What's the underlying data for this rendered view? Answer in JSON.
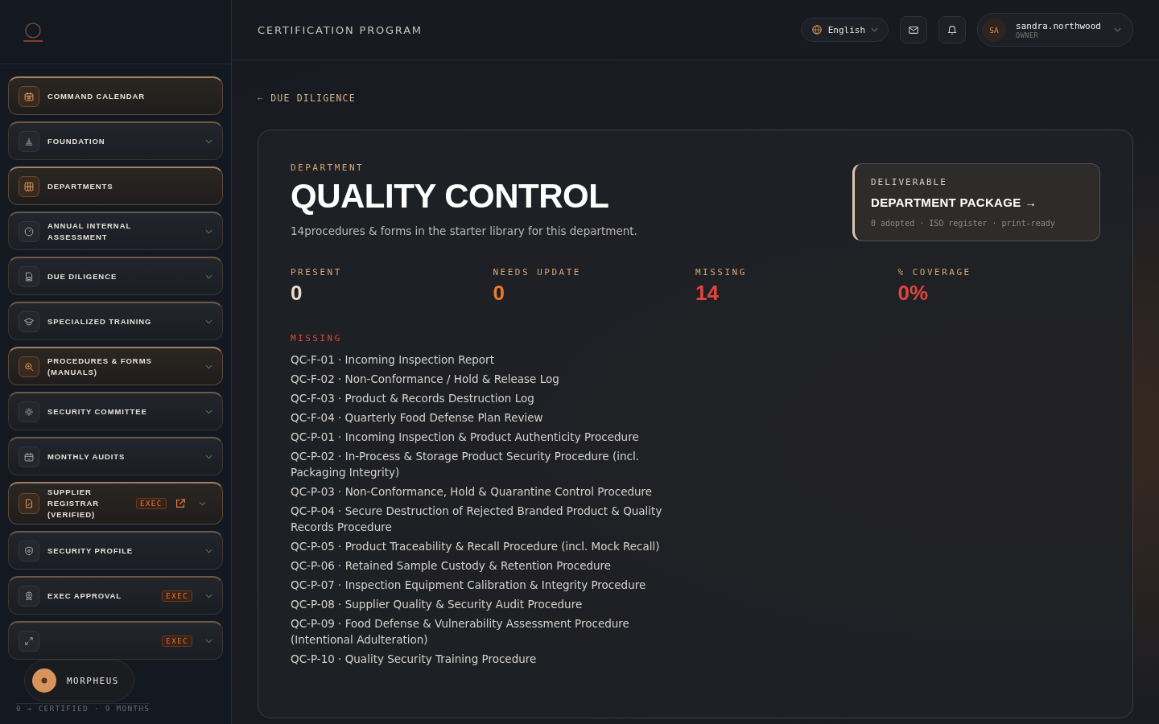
{
  "sidebar": {
    "items": [
      {
        "label": "COMMAND CALENDAR",
        "highlighted": true,
        "expandable": false
      },
      {
        "label": "FOUNDATION",
        "highlighted": false,
        "expandable": true
      },
      {
        "label": "DEPARTMENTS",
        "highlighted": true,
        "expandable": false
      },
      {
        "label": "ANNUAL INTERNAL ASSESSMENT",
        "highlighted": false,
        "expandable": true
      },
      {
        "label": "DUE DILIGENCE",
        "highlighted": false,
        "expandable": true
      },
      {
        "label": "SPECIALIZED TRAINING",
        "highlighted": false,
        "expandable": true
      },
      {
        "label": "PROCEDURES & FORMS (MANUALS)",
        "highlighted": true,
        "expandable": true
      },
      {
        "label": "SECURITY COMMITTEE",
        "highlighted": false,
        "expandable": true
      },
      {
        "label": "MONTHLY AUDITS",
        "highlighted": false,
        "expandable": true
      },
      {
        "label": "SUPPLIER REGISTRAR (VERIFIED)",
        "highlighted": true,
        "expandable": true,
        "badge": "EXEC",
        "external": true
      },
      {
        "label": "SECURITY PROFILE",
        "highlighted": false,
        "expandable": true
      },
      {
        "label": "EXEC APPROVAL",
        "highlighted": false,
        "expandable": true,
        "badge": "EXEC"
      },
      {
        "highlighted": false,
        "expandable": true,
        "badge": "EXEC"
      }
    ],
    "assistant": "MORPHEUS",
    "footer": "0 → CERTIFIED · 9 MONTHS"
  },
  "header": {
    "title": "CERTIFICATION PROGRAM",
    "language": "English",
    "user": {
      "initials": "SA",
      "name": "sandra.northwood",
      "role": "OWNER"
    }
  },
  "back_arrow": "←",
  "back_link": "DUE DILIGENCE",
  "department": {
    "eyebrow": "DEPARTMENT",
    "title": "QUALITY CONTROL",
    "description": "14procedures & forms in the starter library for this department.",
    "deliverable": {
      "eyebrow": "DELIVERABLE",
      "title": "DEPARTMENT PACKAGE →",
      "meta": "0 adopted · ISO register · print-ready"
    },
    "stats": [
      {
        "label": "PRESENT",
        "value": "0",
        "color": "#e8dccb"
      },
      {
        "label": "NEEDS UPDATE",
        "value": "0",
        "color": "#f07a2a"
      },
      {
        "label": "MISSING",
        "value": "14",
        "color": "#e0453c"
      },
      {
        "label": "% COVERAGE",
        "value": "0%",
        "color": "#e0453c"
      }
    ],
    "missing_heading": "MISSING",
    "missing": [
      "QC-F-01 · Incoming Inspection Report",
      "QC-F-02 · Non-Conformance / Hold & Release Log",
      "QC-F-03 · Product & Records Destruction Log",
      "QC-F-04 · Quarterly Food Defense Plan Review",
      "QC-P-01 · Incoming Inspection & Product Authenticity Procedure",
      "QC-P-02 · In-Process & Storage Product Security Procedure (incl. Packaging Integrity)",
      "QC-P-03 · Non-Conformance, Hold & Quarantine Control Procedure",
      "QC-P-04 · Secure Destruction of Rejected Branded Product & Quality Records Procedure",
      "QC-P-05 · Product Traceability & Recall Procedure (incl. Mock Recall)",
      "QC-P-06 · Retained Sample Custody & Retention Procedure",
      "QC-P-07 · Inspection Equipment Calibration & Integrity Procedure",
      "QC-P-08 · Supplier Quality & Security Audit Procedure",
      "QC-P-09 · Food Defense & Vulnerability Assessment Procedure (Intentional Adulteration)",
      "QC-P-10 · Quality Security Training Procedure"
    ]
  }
}
